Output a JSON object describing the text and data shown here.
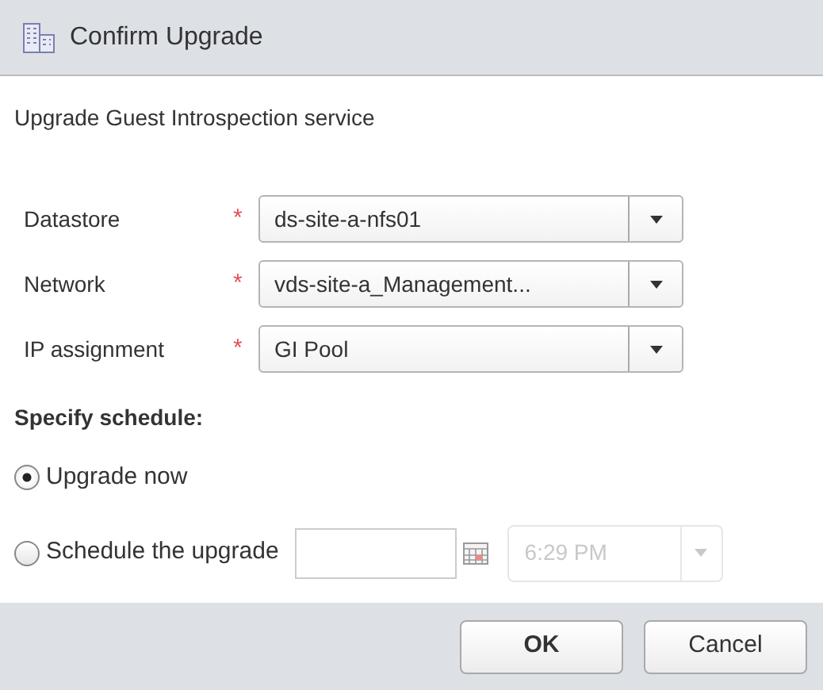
{
  "window": {
    "title": "Confirm Upgrade"
  },
  "subtitle": "Upgrade Guest Introspection service",
  "fields": [
    {
      "label": "Datastore",
      "required_marker": "*",
      "value": "ds-site-a-nfs01"
    },
    {
      "label": "Network",
      "required_marker": "*",
      "value": "vds-site-a_Management..."
    },
    {
      "label": "IP assignment",
      "required_marker": "*",
      "value": "GI Pool"
    }
  ],
  "schedule": {
    "heading": "Specify schedule:",
    "options": [
      {
        "label": "Upgrade now",
        "selected": true
      },
      {
        "label": "Schedule the upgrade",
        "selected": false
      }
    ],
    "time": {
      "value": "6:29 PM",
      "disabled": true
    }
  },
  "buttons": [
    "OK",
    "Cancel"
  ]
}
